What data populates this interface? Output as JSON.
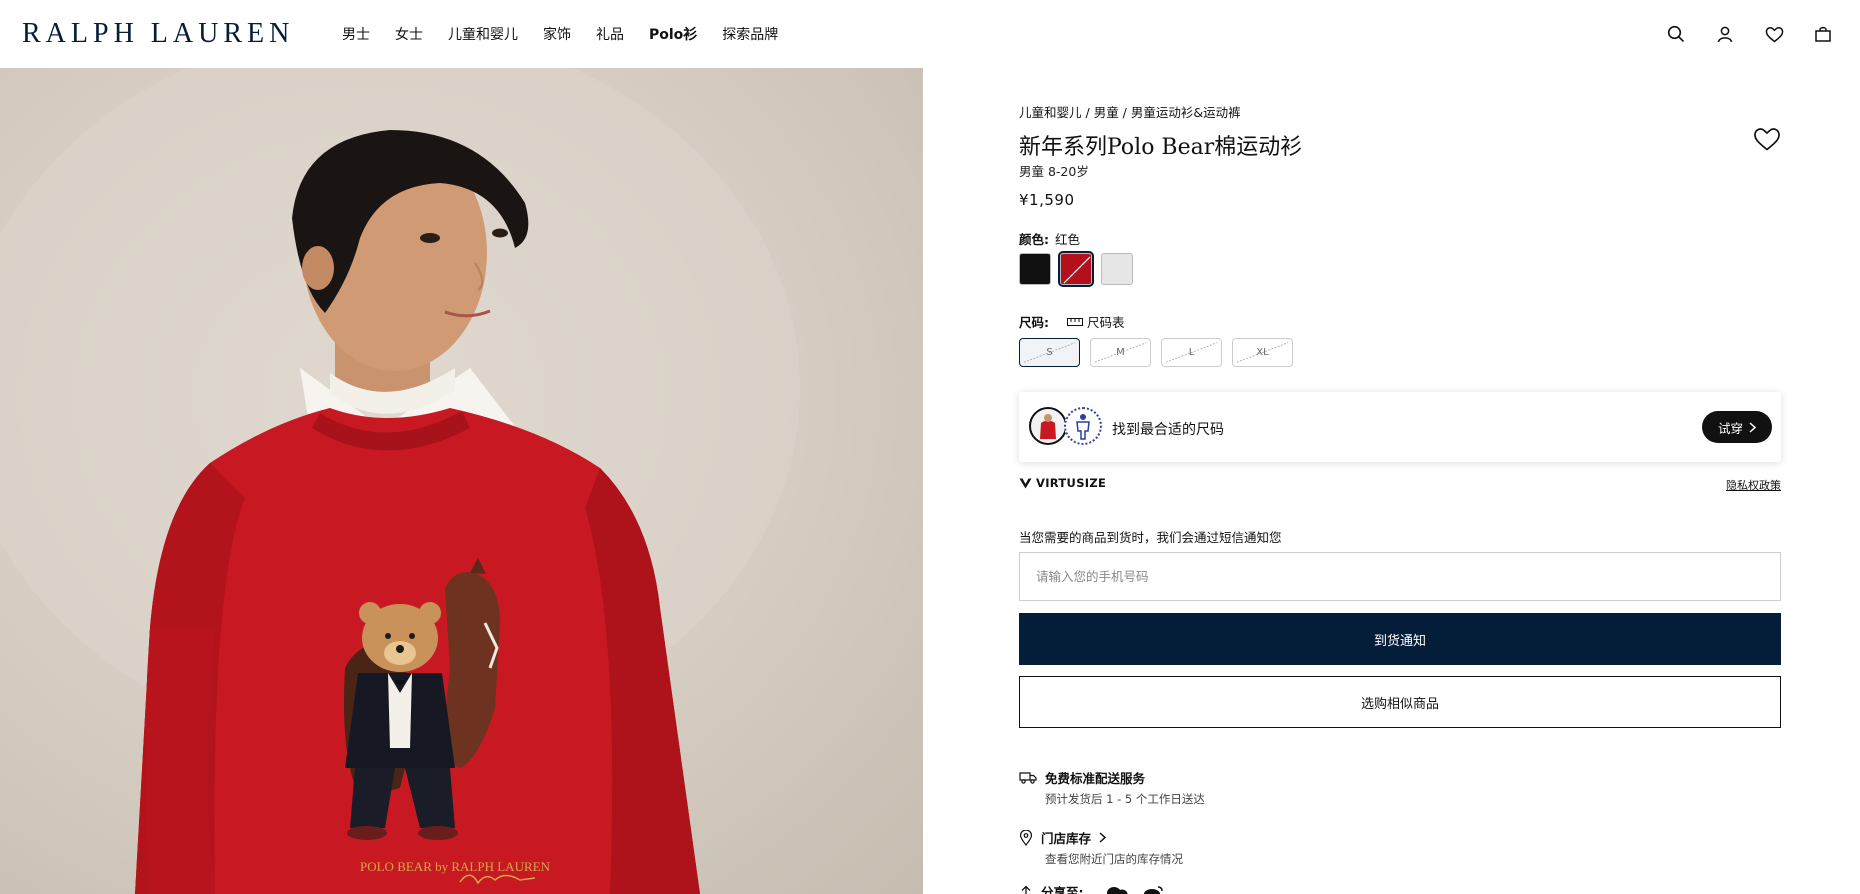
{
  "brand": {
    "logo_text": "RALPH LAUREN",
    "color": "#041e3a"
  },
  "nav": {
    "items": [
      {
        "label": "男士"
      },
      {
        "label": "女士"
      },
      {
        "label": "儿童和婴儿"
      },
      {
        "label": "家饰"
      },
      {
        "label": "礼品"
      },
      {
        "label": "Polo衫"
      },
      {
        "label": "探索品牌"
      }
    ]
  },
  "header_icons": [
    "search-icon",
    "account-icon",
    "wishlist-icon",
    "bag-icon"
  ],
  "hero": {
    "print_text": "POLO BEAR by RALPH LAUREN",
    "signature": "Ralph Lauren"
  },
  "product": {
    "breadcrumb": [
      "儿童和婴儿",
      "男童",
      "男童运动衫&运动裤"
    ],
    "breadcrumb_sep": " / ",
    "title": "新年系列Polo Bear棉运动衫",
    "subtitle": "男童 8-20岁",
    "price": "¥1,590",
    "color_label": "颜色:",
    "color_value": "红色",
    "colors": [
      {
        "name": "黑色",
        "hex": "#111111",
        "selected": false
      },
      {
        "name": "红色",
        "hex": "#b3101c",
        "selected": true
      },
      {
        "name": "白色",
        "hex": "#e6e6e6",
        "selected": false
      }
    ],
    "size_label": "尺码:",
    "size_chart": "尺码表",
    "sizes": [
      {
        "label": "S",
        "selected": true,
        "unavailable": true
      },
      {
        "label": "M",
        "selected": false,
        "unavailable": true
      },
      {
        "label": "L",
        "selected": false,
        "unavailable": true
      },
      {
        "label": "XL",
        "selected": false,
        "unavailable": true
      }
    ]
  },
  "virtusize": {
    "text": "找到最合适的尺码",
    "button": "试穿",
    "brand": "VIRTUSIZE",
    "privacy": "隐私权政策"
  },
  "notify": {
    "text": "当您需要的商品到货时，我们会通过短信通知您",
    "placeholder": "请输入您的手机号码",
    "button": "到货通知",
    "similar_button": "选购相似商品"
  },
  "services": {
    "shipping_title": "免费标准配送服务",
    "shipping_sub": "预计发货后 1 - 5 个工作日送达",
    "store_title": "门店库存",
    "store_sub": "查看您附近门店的库存情况",
    "share_title": "分享至:"
  }
}
